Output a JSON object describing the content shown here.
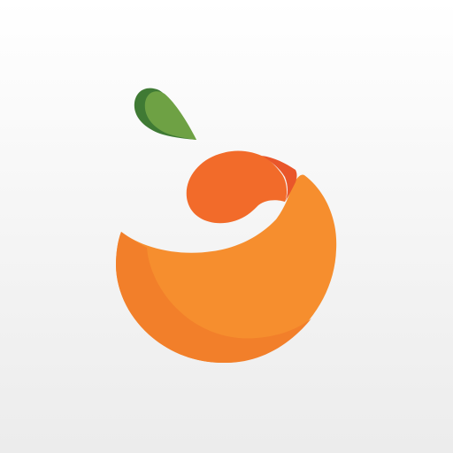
{
  "logo": {
    "icon": "orange-fruit-logo-icon",
    "colors": {
      "body_light": "#F68E2E",
      "body_dark": "#F27F2A",
      "head": "#F26B2A",
      "flap": "#E9562A",
      "leaf_light": "#6EA144",
      "leaf_dark": "#3F7A34",
      "background_top": "#FFFFFF",
      "background_bottom": "#ECECEC"
    }
  }
}
